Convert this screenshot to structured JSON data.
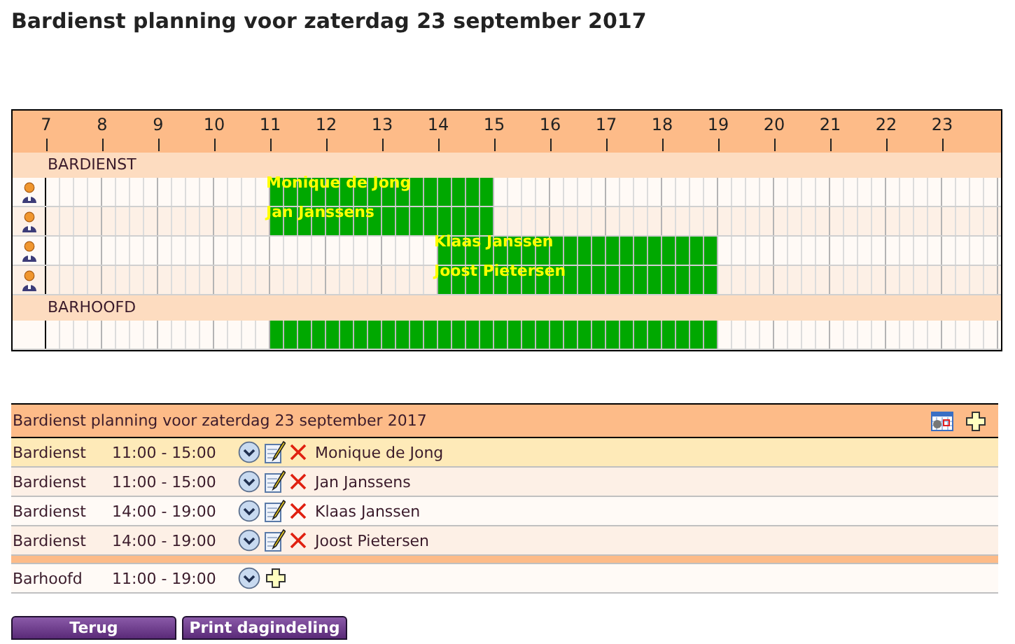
{
  "title": "Bardienst planning voor zaterdag 23 september 2017",
  "timeline": {
    "hours": [
      "7",
      "8",
      "9",
      "10",
      "11",
      "12",
      "13",
      "14",
      "15",
      "16",
      "17",
      "18",
      "19",
      "20",
      "21",
      "22",
      "23"
    ]
  },
  "sections": [
    {
      "label": "BARDIENST",
      "rows": [
        {
          "kind": "person",
          "name": "Monique de Jong"
        },
        {
          "kind": "person",
          "name": "Jan Janssens"
        },
        {
          "kind": "person",
          "name": "Klaas Janssen"
        },
        {
          "kind": "person",
          "name": "Joost Pietersen"
        }
      ]
    },
    {
      "label": "BARHOOFD",
      "rows": [
        {
          "kind": "open"
        }
      ]
    }
  ],
  "list": {
    "title": "Bardienst planning voor zaterdag 23 september 2017",
    "groups": [
      {
        "entries": [
          {
            "kind": "assigned",
            "role": "Bardienst",
            "time": "11:00 - 15:00",
            "name": "Monique de Jong",
            "highlighted": true
          },
          {
            "kind": "assigned",
            "role": "Bardienst",
            "time": "11:00 - 15:00",
            "name": "Jan Janssens",
            "highlighted": false
          },
          {
            "kind": "assigned",
            "role": "Bardienst",
            "time": "14:00 - 19:00",
            "name": "Klaas Janssen",
            "highlighted": false
          },
          {
            "kind": "assigned",
            "role": "Bardienst",
            "time": "14:00 - 19:00",
            "name": "Joost Pietersen",
            "highlighted": false
          }
        ]
      },
      {
        "entries": [
          {
            "kind": "open",
            "role": "Barhoofd",
            "time": "11:00 - 19:00",
            "highlighted": false
          }
        ]
      }
    ]
  },
  "buttons": [
    "Terug",
    "Print dagindeling"
  ]
}
